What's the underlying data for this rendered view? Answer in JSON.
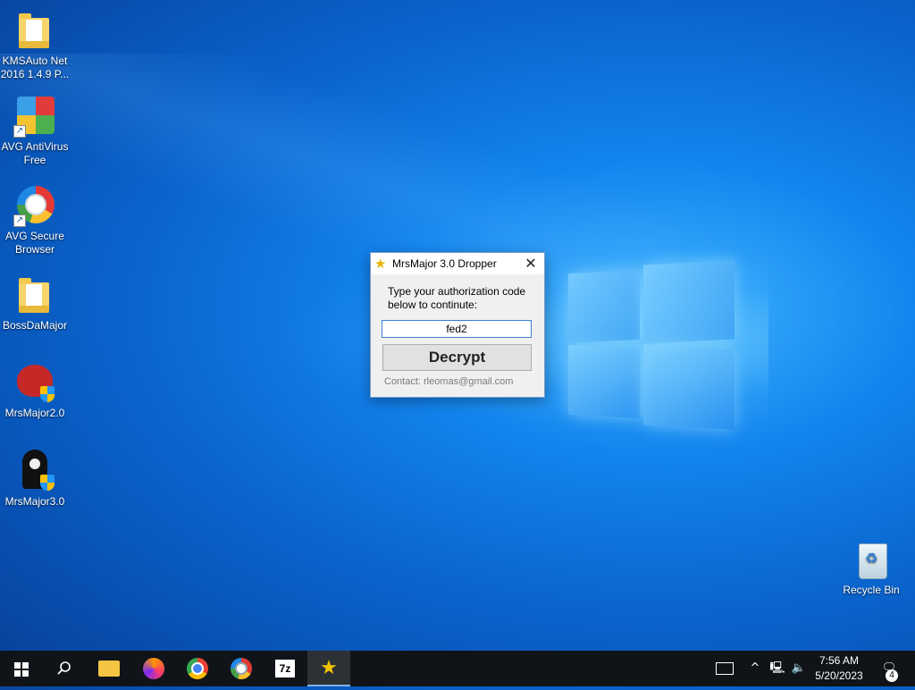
{
  "desktop": {
    "icons": [
      {
        "label": "KMSAuto Net 2016 1.4.9 P...",
        "icon": "folder-icon"
      },
      {
        "label": "AVG AntiVirus Free",
        "icon": "avg-antivirus-icon"
      },
      {
        "label": "AVG Secure Browser",
        "icon": "avg-browser-icon"
      },
      {
        "label": "BossDaMajor",
        "icon": "folder-icon"
      },
      {
        "label": "MrsMajor2.0",
        "icon": "devil-icon"
      },
      {
        "label": "MrsMajor3.0",
        "icon": "reaper-icon"
      }
    ],
    "recycle_bin": {
      "label": "Recycle Bin",
      "icon": "recycle-bin-icon"
    }
  },
  "dialog": {
    "title": "MrsMajor 3.0 Dropper",
    "close_glyph": "✕",
    "prompt": "Type your authorization code below to continute:",
    "code_value": "fed2",
    "decrypt_label": "Decrypt",
    "contact": "Contact: rleomas@gmail.com"
  },
  "taskbar": {
    "apps": [
      {
        "name": "start",
        "icon": "windows-start-icon"
      },
      {
        "name": "search",
        "icon": "search-icon"
      },
      {
        "name": "file-explorer",
        "icon": "folder-icon"
      },
      {
        "name": "firefox",
        "icon": "firefox-icon"
      },
      {
        "name": "chrome",
        "icon": "chrome-icon"
      },
      {
        "name": "avg-secure-browser",
        "icon": "avg-browser-icon"
      },
      {
        "name": "7zip",
        "icon": "7zip-icon",
        "text": "7z"
      },
      {
        "name": "mrsmajor-dropper",
        "icon": "star-icon",
        "active": true
      }
    ],
    "clock": {
      "time": "7:56 AM",
      "date": "5/20/2023"
    },
    "notifications_count": "4"
  },
  "colors": {
    "accent": "#0a63cc",
    "taskbar": "#101418",
    "input_border": "#3c7fd2"
  }
}
